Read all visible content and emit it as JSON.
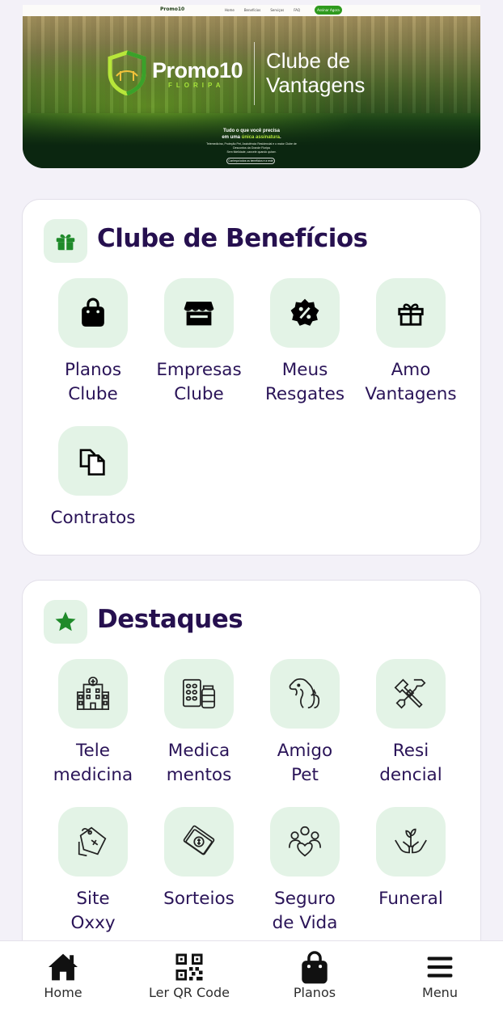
{
  "banner": {
    "mini_logo": "Promo10",
    "mini_links": [
      "Home",
      "Benefícios",
      "Serviços",
      "FAQ"
    ],
    "mini_button": "Assinar Agora",
    "brand_name": "Promo10",
    "brand_sub": "FLORIPA",
    "club_title_line1": "Clube de",
    "club_title_line2": "Vantagens",
    "tagline_line1": "Tudo o que você precisa",
    "tagline_line2_prefix": "em uma ",
    "tagline_line2_highlight": "única assinatura",
    "tagline_line2_suffix": ".",
    "tag_small_line1": "Telemedicina, Proteção Pet, Assistência Residencial e o maior Clube de",
    "tag_small_line2": "Descontos da Grande Floripa",
    "tag_small_line3": "Sem fidelidade, cancele quando quiser.",
    "tag_button": "Conheça todos os benefícios e a rede"
  },
  "clube": {
    "title": "Clube de Benefícios",
    "icon": "gift-icon",
    "items": [
      {
        "label": "Planos\nClube",
        "icon": "shopping-bag-icon"
      },
      {
        "label": "Empresas\nClube",
        "icon": "storefront-icon"
      },
      {
        "label": "Meus\nResgates",
        "icon": "discount-badge-icon"
      },
      {
        "label": "Amo\nVantagens",
        "icon": "gift-outline-icon"
      },
      {
        "label": "Contratos",
        "icon": "documents-icon"
      }
    ]
  },
  "destaques": {
    "title": "Destaques",
    "icon": "star-icon",
    "items": [
      {
        "label": "Tele\nmedicina",
        "icon": "hospital-icon"
      },
      {
        "label": "Medica\nmentos",
        "icon": "medicine-icon"
      },
      {
        "label": "Amigo\nPet",
        "icon": "pet-icon"
      },
      {
        "label": "Resi\ndencial",
        "icon": "tools-icon"
      },
      {
        "label": "Site\nOxxy",
        "icon": "price-tag-icon"
      },
      {
        "label": "Sorteios",
        "icon": "money-icon"
      },
      {
        "label": "Seguro\nde Vida",
        "icon": "family-heart-icon"
      },
      {
        "label": "Funeral",
        "icon": "hands-plant-icon"
      }
    ]
  },
  "bottom_nav": [
    {
      "label": "Home",
      "icon": "home-icon"
    },
    {
      "label": "Ler QR Code",
      "icon": "qr-code-icon"
    },
    {
      "label": "Planos",
      "icon": "shopping-bag-icon"
    },
    {
      "label": "Menu",
      "icon": "hamburger-menu-icon"
    }
  ],
  "colors": {
    "background": "#f3f1f8",
    "accent_green": "#1f7a1f",
    "tile_bg": "#e3f3e6",
    "title_purple": "#26104f",
    "label_purple": "#2a1458"
  }
}
